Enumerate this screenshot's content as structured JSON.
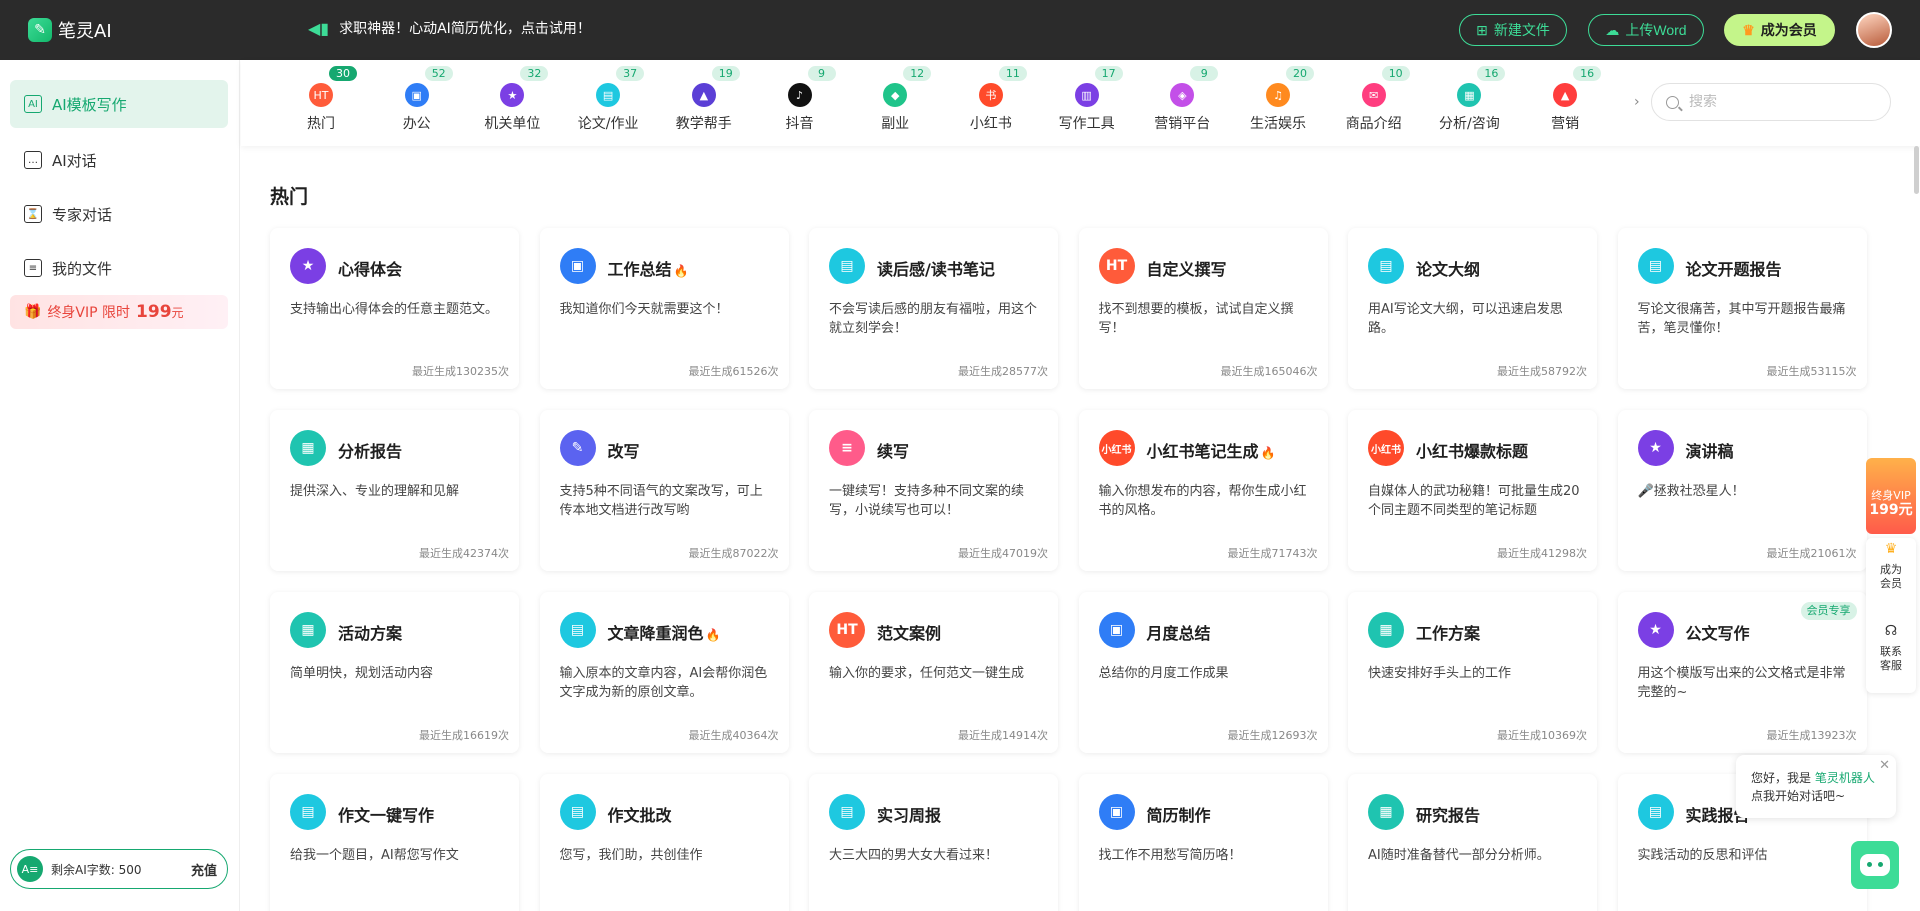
{
  "app": {
    "name": "笔灵AI"
  },
  "header": {
    "promo_text": "求职神器！心动AI简历优化，点击试用！",
    "new_file_label": "新建文件",
    "upload_word_label": "上传Word",
    "become_member_label": "成为会员"
  },
  "sidebar": {
    "items": [
      {
        "label": "AI模板写作",
        "icon": "ai-template-icon"
      },
      {
        "label": "AI对话",
        "icon": "chat-icon"
      },
      {
        "label": "专家对话",
        "icon": "expert-icon"
      },
      {
        "label": "我的文件",
        "icon": "file-icon"
      }
    ],
    "vip_banner": {
      "prefix": "终身VIP 限时",
      "price": "199",
      "unit": "元"
    },
    "quota": {
      "label": "剩余AI字数: 500",
      "charge_label": "充值"
    }
  },
  "categories": [
    {
      "label": "热门",
      "count": "30",
      "color": "#ff5b3a",
      "glyph": "HT"
    },
    {
      "label": "办公",
      "count": "52",
      "color": "#2f7df6",
      "glyph": "▣"
    },
    {
      "label": "机关单位",
      "count": "32",
      "color": "#7b3fe4",
      "glyph": "★"
    },
    {
      "label": "论文/作业",
      "count": "37",
      "color": "#1ec8e0",
      "glyph": "▤"
    },
    {
      "label": "教学帮手",
      "count": "19",
      "color": "#5b3fd6",
      "glyph": "▲"
    },
    {
      "label": "抖音",
      "count": "9",
      "color": "#111111",
      "glyph": "♪"
    },
    {
      "label": "副业",
      "count": "12",
      "color": "#1fc48a",
      "glyph": "◆"
    },
    {
      "label": "小红书",
      "count": "11",
      "color": "#ff4a2a",
      "glyph": "书"
    },
    {
      "label": "写作工具",
      "count": "17",
      "color": "#7b3fe4",
      "glyph": "▥"
    },
    {
      "label": "营销平台",
      "count": "9",
      "color": "#c34fe8",
      "glyph": "◈"
    },
    {
      "label": "生活娱乐",
      "count": "20",
      "color": "#ff8a1f",
      "glyph": "♫"
    },
    {
      "label": "商品介绍",
      "count": "10",
      "color": "#ff3d7f",
      "glyph": "✉"
    },
    {
      "label": "分析/咨询",
      "count": "16",
      "color": "#1fc4b0",
      "glyph": "▦"
    },
    {
      "label": "营销",
      "count": "16",
      "color": "#ff3d3d",
      "glyph": "▲"
    }
  ],
  "search": {
    "placeholder": "搜索"
  },
  "section": {
    "title": "热门"
  },
  "cards": [
    {
      "title": "心得体会",
      "hot": false,
      "desc": "支持输出心得体会的任意主题范文。",
      "count": "最近生成130235次",
      "color": "#7b3fe4",
      "glyph": "★"
    },
    {
      "title": "工作总结",
      "hot": true,
      "desc": "我知道你们今天就需要这个！",
      "count": "最近生成61526次",
      "color": "#2f7df6",
      "glyph": "▣"
    },
    {
      "title": "读后感/读书笔记",
      "hot": false,
      "desc": "不会写读后感的朋友有福啦，用这个就立刻学会！",
      "count": "最近生成28577次",
      "color": "#1ec8e0",
      "glyph": "▤"
    },
    {
      "title": "自定义撰写",
      "hot": false,
      "desc": "找不到想要的模板，试试自定义撰写！",
      "count": "最近生成165046次",
      "color": "#ff5b3a",
      "glyph": "HT"
    },
    {
      "title": "论文大纲",
      "hot": false,
      "desc": "用AI写论文大纲，可以迅速启发思路。",
      "count": "最近生成58792次",
      "color": "#1ec8e0",
      "glyph": "▤"
    },
    {
      "title": "论文开题报告",
      "hot": false,
      "desc": "写论文很痛苦，其中写开题报告最痛苦，笔灵懂你！",
      "count": "最近生成53115次",
      "color": "#1ec8e0",
      "glyph": "▤"
    },
    {
      "title": "分析报告",
      "hot": false,
      "desc": "提供深入、专业的理解和见解",
      "count": "最近生成42374次",
      "color": "#1fc4b0",
      "glyph": "▦"
    },
    {
      "title": "改写",
      "hot": false,
      "desc": "支持5种不同语气的文案改写，可上传本地文档进行改写哟",
      "count": "最近生成87022次",
      "color": "#5b63f0",
      "glyph": "✎"
    },
    {
      "title": "续写",
      "hot": false,
      "desc": "一键续写！支持多种不同文案的续写，小说续写也可以！",
      "count": "最近生成47019次",
      "color": "#ff5b8a",
      "glyph": "≡"
    },
    {
      "title": "小红书笔记生成",
      "hot": true,
      "desc": "输入你想发布的内容，帮你生成小红书的风格。",
      "count": "最近生成71743次",
      "color": "#ff4a2a",
      "glyph": "小红书"
    },
    {
      "title": "小红书爆款标题",
      "hot": false,
      "desc": "自媒体人的武功秘籍！可批量生成20个同主题不同类型的笔记标题",
      "count": "最近生成41298次",
      "color": "#ff4a2a",
      "glyph": "小红书"
    },
    {
      "title": "演讲稿",
      "hot": false,
      "desc": "🎤拯救社恐星人！",
      "count": "最近生成21061次",
      "color": "#7b3fe4",
      "glyph": "★"
    },
    {
      "title": "活动方案",
      "hot": false,
      "desc": "简单明快，规划活动内容",
      "count": "最近生成16619次",
      "color": "#1fc4b0",
      "glyph": "▦"
    },
    {
      "title": "文章降重润色",
      "hot": true,
      "desc": "输入原本的文章内容，AI会帮你润色文字成为新的原创文章。",
      "count": "最近生成40364次",
      "color": "#1ec8e0",
      "glyph": "▤"
    },
    {
      "title": "范文案例",
      "hot": false,
      "desc": "输入你的要求，任何范文一键生成",
      "count": "最近生成14914次",
      "color": "#ff5b3a",
      "glyph": "HT"
    },
    {
      "title": "月度总结",
      "hot": false,
      "desc": "总结你的月度工作成果",
      "count": "最近生成12693次",
      "color": "#2f7df6",
      "glyph": "▣"
    },
    {
      "title": "工作方案",
      "hot": false,
      "desc": "快速安排好手头上的工作",
      "count": "最近生成10369次",
      "color": "#1fc4b0",
      "glyph": "▦"
    },
    {
      "title": "公文写作",
      "hot": false,
      "desc": "用这个模版写出来的公文格式是非常完整的~",
      "count": "最近生成13923次",
      "color": "#7b3fe4",
      "glyph": "★",
      "tag": "会员专享"
    },
    {
      "title": "作文一键写作",
      "hot": false,
      "desc": "给我一个题目，AI帮您写作文",
      "count": "",
      "color": "#1ec8e0",
      "glyph": "▤"
    },
    {
      "title": "作文批改",
      "hot": false,
      "desc": "您写，我们助，共创佳作",
      "count": "",
      "color": "#1ec8e0",
      "glyph": "▤"
    },
    {
      "title": "实习周报",
      "hot": false,
      "desc": "大三大四的男大女大看过来！",
      "count": "",
      "color": "#1ec8e0",
      "glyph": "▤"
    },
    {
      "title": "简历制作",
      "hot": false,
      "desc": "找工作不用愁写简历咯！",
      "count": "",
      "color": "#2f7df6",
      "glyph": "▣"
    },
    {
      "title": "研究报告",
      "hot": false,
      "desc": "AI随时准备替代一部分分析师。",
      "count": "",
      "color": "#1fc4b0",
      "glyph": "▦"
    },
    {
      "title": "实践报告",
      "hot": false,
      "desc": "实践活动的反思和评估",
      "count": "",
      "color": "#1ec8e0",
      "glyph": "▤"
    }
  ],
  "float": {
    "vip_line1": "终身VIP",
    "vip_price": "199元",
    "member_label": "成为会员",
    "service_label": "联系客服"
  },
  "chat": {
    "greeting_prefix": "您好，我是",
    "bot_name": "笔灵机器人",
    "greeting_line2": "点我开始对话吧~"
  }
}
